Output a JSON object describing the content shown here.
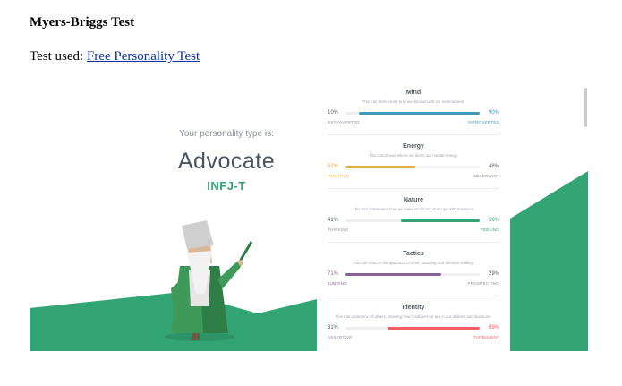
{
  "heading": "Myers-Briggs Test",
  "test_used": {
    "prefix": "Test used: ",
    "link_text": "Free Personality Test"
  },
  "result": {
    "intro": "Your personality type is:",
    "type_name": "Advocate",
    "type_code": "INFJ-T"
  },
  "traits": [
    {
      "title": "Mind",
      "desc": "This trait determines how we interact with our environment.",
      "left_pct": "10%",
      "right_pct": "90%",
      "left_label": "EXTRAVERTED",
      "right_label": "INTROVERTED",
      "dominant": "right",
      "value": 90,
      "color": "#4298b4"
    },
    {
      "title": "Energy",
      "desc": "This trait shows where we direct our mental energy.",
      "left_pct": "52%",
      "right_pct": "48%",
      "left_label": "INTUITIVE",
      "right_label": "OBSERVANT",
      "dominant": "left",
      "value": 52,
      "color": "#e4ae3a"
    },
    {
      "title": "Nature",
      "desc": "This trait determines how we make decisions and cope with emotions.",
      "left_pct": "41%",
      "right_pct": "59%",
      "left_label": "THINKING",
      "right_label": "FEELING",
      "dominant": "right",
      "value": 59,
      "color": "#33a474"
    },
    {
      "title": "Tactics",
      "desc": "This trait reflects our approach to work, planning and decision-making.",
      "left_pct": "71%",
      "right_pct": "29%",
      "left_label": "JUDGING",
      "right_label": "PROSPECTING",
      "dominant": "left",
      "value": 71,
      "color": "#88619a"
    },
    {
      "title": "Identity",
      "desc": "This trait underpins all others, showing how confident we are in our abilities and decisions.",
      "left_pct": "31%",
      "right_pct": "69%",
      "left_label": "ASSERTIVE",
      "right_label": "TURBULENT",
      "dominant": "right",
      "value": 69,
      "color": "#f25e62"
    }
  ],
  "colors": {
    "accent_green": "#33a474",
    "link": "#0b2fa0",
    "neutral_text": "#555c66"
  },
  "icons": {
    "avatar": "advocate-sage-figure"
  }
}
